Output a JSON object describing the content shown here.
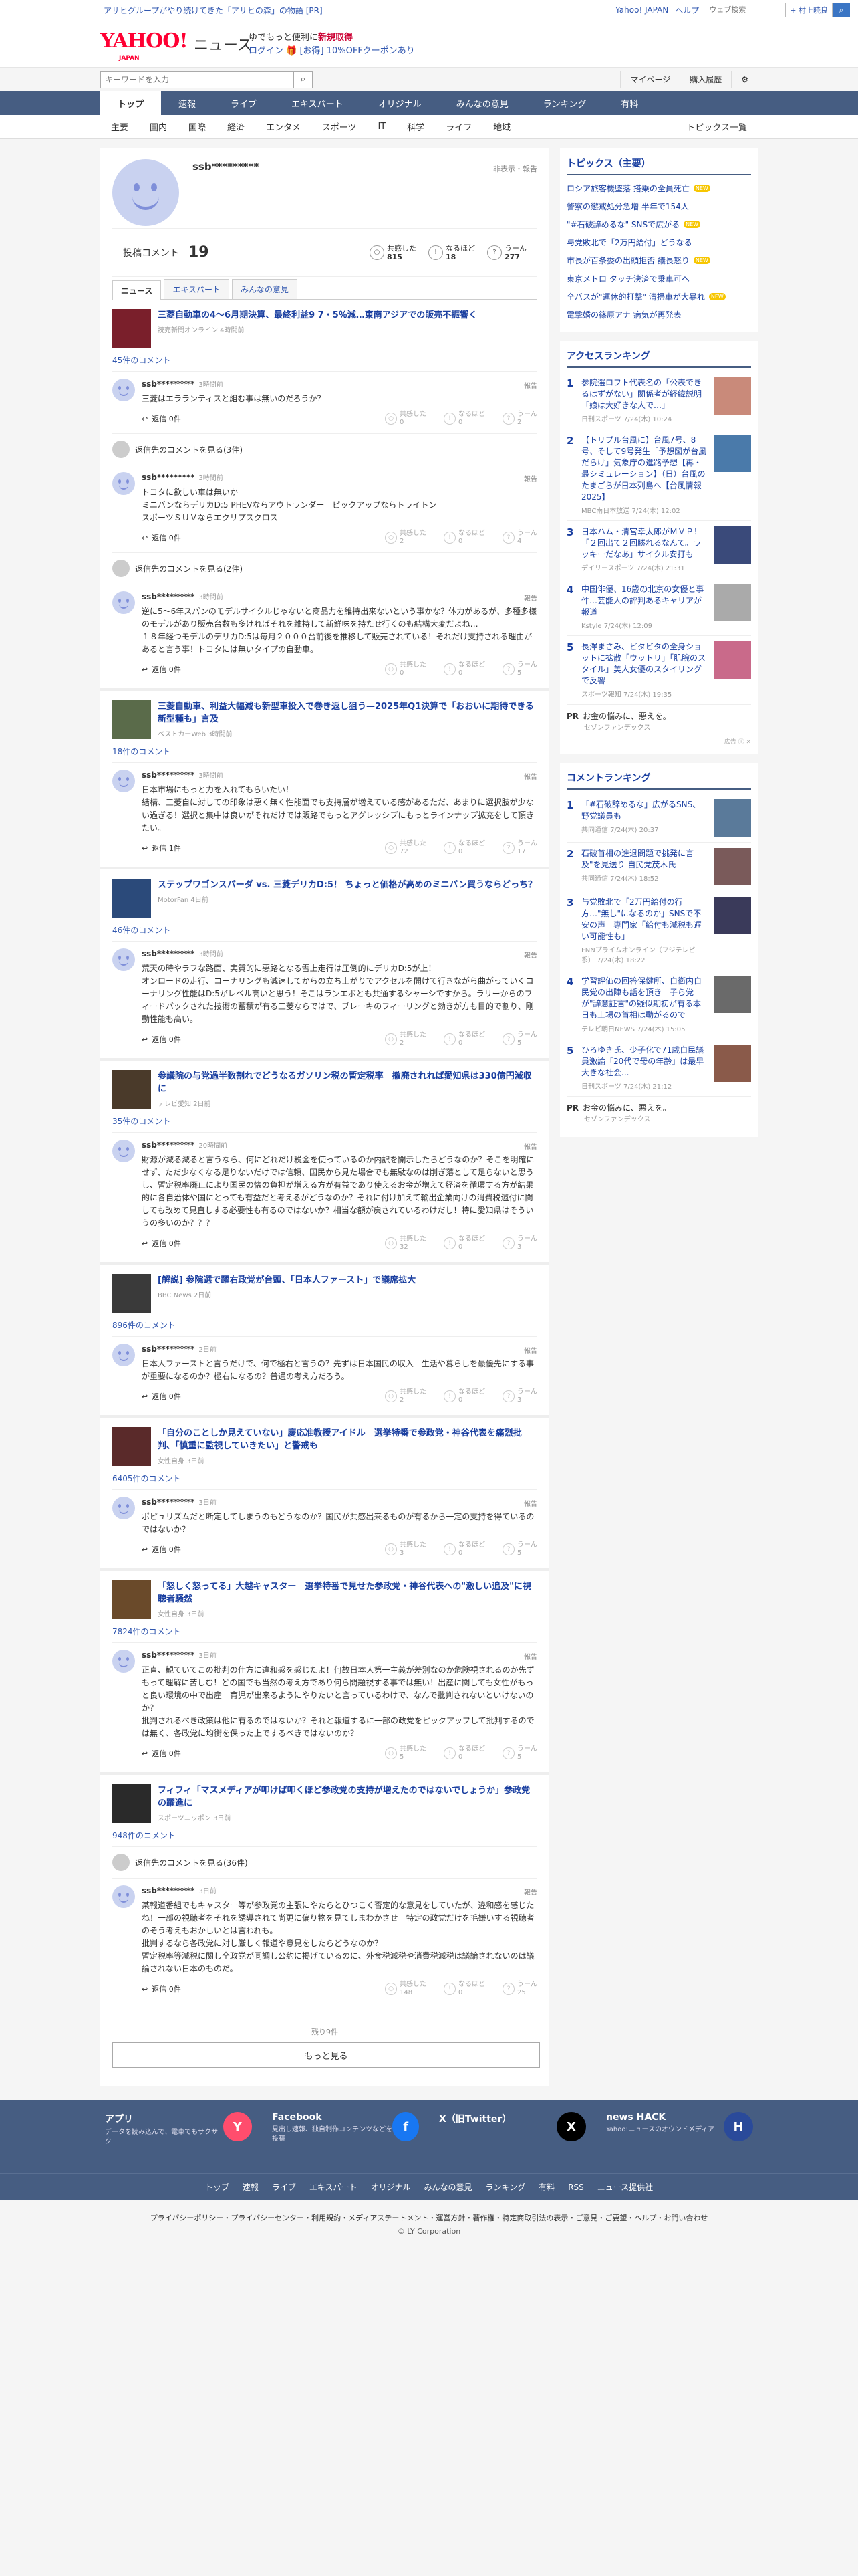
{
  "promo": {
    "text": "アサヒグループがやり続けてきた「アサヒの森」の物語 [PR]",
    "links": [
      "Yahoo! JAPAN",
      "ヘルプ"
    ],
    "search_placeholder": "ウェブ検索",
    "search_btn": "+ 村上暁良"
  },
  "header": {
    "logo": "YAHOO!",
    "logo_sub": "JAPAN",
    "news": "ニュース",
    "tag1": "ゆでもっと便利に",
    "tag1b": "新規取得",
    "login": "ログイン 🎁 [お得] 10%OFFクーポンあり"
  },
  "search": {
    "placeholder": "キーワードを入力",
    "mypage": "マイページ",
    "purchase": "購入履歴"
  },
  "gnav": [
    "トップ",
    "速報",
    "ライブ",
    "エキスパート",
    "オリジナル",
    "みんなの意見",
    "ランキング",
    "有料"
  ],
  "subnav": [
    "主要",
    "国内",
    "国際",
    "経済",
    "エンタメ",
    "スポーツ",
    "IT",
    "科学",
    "ライフ",
    "地域"
  ],
  "subnav_right": "トピックス一覧",
  "profile": {
    "name": "ssb*********",
    "report": "非表示・報告",
    "comment_label": "投稿コメント",
    "comment_count": "19"
  },
  "stats": [
    {
      "label": "共感した",
      "value": "815",
      "icon": "○"
    },
    {
      "label": "なるほど",
      "value": "18",
      "icon": "!"
    },
    {
      "label": "うーん",
      "value": "277",
      "icon": "?"
    }
  ],
  "tabs": [
    "ニュース",
    "エキスパート",
    "みんなの意見"
  ],
  "articles": [
    {
      "title": "三菱自動車の4～6月期決算、最終利益9 7・5％減…東南アジアでの販売不振響く",
      "src": "読売新聞オンライン 4時間前",
      "count": "45件のコメント",
      "thumb": "#7a1f2b",
      "comments": [
        {
          "name": "ssb*********",
          "time": "3時間前",
          "text": "三菱はエラランティスと組む事は無いのだろうか？",
          "reply": "返信 0件",
          "r": [
            "0",
            "0",
            "2"
          ]
        },
        {
          "more": "返信先のコメントを見る(3件)"
        },
        {
          "name": "ssb*********",
          "time": "3時間前",
          "text": "トヨタに欲しい車は無いか\nミニバンならデリカD:5 PHEVならアウトランダー　ピックアップならトライトン\nスポーツＳＵＶならエクリプスクロス",
          "reply": "返信 0件",
          "r": [
            "2",
            "0",
            "4"
          ]
        },
        {
          "more": "返信先のコメントを見る(2件)"
        },
        {
          "name": "ssb*********",
          "time": "3時間前",
          "text": "逆に5～6年スパンのモデルサイクルじゃないと商品力を維持出来ないという事かな？体力があるが、多種多様のモデルがあり販売台数も多ければそれを維持して新鮮味を持たせ行くのも結構大変だよね…\n１８年経つモデルのデリカD:5は毎月２０００台前後を推移して販売されている！それだけ支持される理由があると言う事！トヨタには無いタイプの自動車。",
          "reply": "返信 0件",
          "r": [
            "0",
            "0",
            "5"
          ]
        }
      ]
    },
    {
      "title": "三菱自動車、利益大幅減も新型車投入で巻き返し狙う—2025年Q1決算で「おおいに期待できる新型種も」言及",
      "src": "ベストカーWeb 3時間前",
      "count": "18件のコメント",
      "thumb": "#5a6b4a",
      "comments": [
        {
          "name": "ssb*********",
          "time": "3時間前",
          "text": "日本市場にもっと力を入れてもらいたい！\n結構、三菱自に対しての印象は悪く無く性能面でも支持層が増えている感があるただ、あまりに選択肢が少ない過ぎる！選択と集中は良いがそれだけでは販路でもっとアグレッシブにもっとラインナップ拡充をして頂きたい。",
          "reply": "返信 1件",
          "r": [
            "72",
            "0",
            "17"
          ]
        }
      ]
    },
    {
      "title": "ステップワゴンスパーダ vs. 三菱デリカD:5！ ちょっと価格が高めのミニバン買うならどっち？",
      "src": "MotorFan 4日前",
      "count": "46件のコメント",
      "thumb": "#2b4a7a",
      "comments": [
        {
          "name": "ssb*********",
          "time": "3時間前",
          "text": "荒天の時やラフな路面、実質的に悪路となる雪上走行は圧倒的にデリカD:5が上！\nオンロードの走行、コーナリングも減速してからの立ち上がりでアクセルを開けて行きながら曲がっていくコーナリング性能はD:5がレベル高いと思う！そこはランエボとも共通するシャーシですから。ラリーからのフィードバックされた技術の蓄積が有る三菱ならではで、ブレーキのフィーリングと効きが方も目的で割り、剛動性能も高い。",
          "reply": "返信 0件",
          "r": [
            "2",
            "0",
            "5"
          ]
        }
      ]
    },
    {
      "title": "参議院の与党過半数割れでどうなるガソリン税の暫定税率　撤廃されれば愛知県は330億円減収に",
      "src": "テレビ愛知 2日前",
      "count": "35件のコメント",
      "thumb": "#4a3a2a",
      "comments": [
        {
          "name": "ssb*********",
          "time": "20時間前",
          "text": "財源が減る減ると言うなら、何にどれだけ税金を使っているのか内訳を開示したらどうなのか？そこを明確にせず、ただ少なくなる足りないだけでは信頼、国民から見た場合でも無駄なのは削ぎ落として足らないと思うし、暫定税率廃止により国民の懐の負担が増える方が有益であり使えるお金が増えて経済を循環する方が結果的に各自治体や国にとっても有益だと考えるがどうなのか？それに付け加えて輸出企業向けの消費税還付に関しても改めて見直しする必要性も有るのではないか？相当な額が戻されているわけだし！特に愛知県はそういうの多いのか？？？",
          "reply": "返信 0件",
          "r": [
            "32",
            "0",
            "3"
          ]
        }
      ]
    },
    {
      "title": "[解説] 参院選で躍右政党が台頭、「日本人ファースト」で議席拡大",
      "src": "BBC News 2日前",
      "count": "896件のコメント",
      "thumb": "#3a3a3a",
      "comments": [
        {
          "name": "ssb*********",
          "time": "2日前",
          "text": "日本人ファーストと言うだけで、何で極右と言うの？先ずは日本国民の収入　生活や暮らしを最優先にする事が重要になるのか？極右になるの？普通の考え方だろう。",
          "reply": "返信 0件",
          "r": [
            "2",
            "0",
            "3"
          ]
        }
      ]
    },
    {
      "title": "「自分のことしか見えていない」慶応准教授アイドル　選挙特番で参政党・神谷代表を痛烈批判、「慎重に監視していきたい」と警戒も",
      "src": "女性自身 3日前",
      "count": "6405件のコメント",
      "thumb": "#5a2a2a",
      "comments": [
        {
          "name": "ssb*********",
          "time": "3日前",
          "text": "ポピュリズムだと断定してしまうのもどうなのか？国民が共感出来るものが有るから一定の支持を得ているのではないか？",
          "reply": "返信 0件",
          "r": [
            "3",
            "0",
            "5"
          ]
        }
      ]
    },
    {
      "title": "「怒しく怒ってる」大越キャスター　選挙特番で見せた参政党・神谷代表への\"激しい追及\"に視聴者騒然",
      "src": "女性自身 3日前",
      "count": "7824件のコメント",
      "thumb": "#6a4a2a",
      "comments": [
        {
          "name": "ssb*********",
          "time": "3日前",
          "text": "正直、観ていてこの批判の仕方に違和感を感じたよ！何故日本人第一主義が差別なのか危険視されるのか先ずもって理解に苦しむ！どの国でも当然の考え方であり何ら問題視する事では無い！出産に関しても女性がもっと良い環境の中で出産　育児が出来るようにやりたいと言っているわけで、なんで批判されないといけないのか？\n批判されるべき政策は他に有るのではないか？それと報道するに一部の政党をピックアップして批判するのでは無く、各政党に均衡を保った上でするべきではないのか？",
          "reply": "返信 0件",
          "r": [
            "5",
            "0",
            "5"
          ]
        }
      ]
    },
    {
      "title": "フィフィ「マスメディアが叩けば叩くほど参政党の支持が増えたのではないでしょうか」参政党の躍進に",
      "src": "スポーツニッポン 3日前",
      "count": "948件のコメント",
      "thumb": "#2a2a2a",
      "comments": [
        {
          "more": "返信先のコメントを見る(36件)"
        },
        {
          "name": "ssb*********",
          "time": "3日前",
          "text": "某報道番組でもキャスター等が参政党の主張にやたらとひつこく否定的な意見をしていたが、違和感を感じたね！一部の視聴者をそれを誘導されて尚更に偏り物を見てしまわかさせ　特定の政党だけを毛嫌いする視聴者のそう考えもおかしいとは言われも。\n批判するなら各政党に対し厳しく報道や意見をしたらどうなのか？\n暫定税率等減税に関し全政党が同調し公約に掲げているのに、外食税減税や消費税減税は議論されないのは議論されない日本のものだ。",
          "reply": "返信 0件",
          "r": [
            "148",
            "0",
            "25"
          ]
        }
      ]
    }
  ],
  "footer_main": {
    "total": "残り9件",
    "more": "もっと見る"
  },
  "sidebar": {
    "topics_title": "トピックス（主要）",
    "topics": [
      {
        "t": "ロシア旅客機墜落 搭乗の全員死亡",
        "n": true
      },
      {
        "t": "警察の懲戒処分急増 半年で154人",
        "n": false
      },
      {
        "t": "\"#石破辞めるな\" SNSで広がる",
        "n": true
      },
      {
        "t": "与党敗北で「2万円給付」どうなる",
        "n": false
      },
      {
        "t": "市長が百条委の出頭拒否 議長怒り",
        "n": true
      },
      {
        "t": "東京メトロ タッチ決済で乗車可へ",
        "n": false
      },
      {
        "t": "全バスが\"運休的打撃\" 清掃車が大暴れ",
        "n": true
      },
      {
        "t": "電撃婚の篠原アナ 病気が再発表",
        "n": false
      }
    ],
    "access_title": "アクセスランキング",
    "access": [
      {
        "n": "1",
        "t": "参院選ロフト代表名の「公表できるはずがない」関係者が経緯説明「娘は大好きな人で…」",
        "s": "日刊スポーツ 7/24(木) 10:24",
        "c": "#c98a7a"
      },
      {
        "n": "2",
        "t": "【トリプル台風に】台風7号、8号、そして9号発生「予想図が台風だらけ」気象庁の進路予想【再・最シミュレーション】（日）台風のたまごらが日本列島へ【台風情報2025】",
        "s": "MBC南日本放送 7/24(木) 12:02",
        "c": "#4a7aaa"
      },
      {
        "n": "3",
        "t": "日本ハム・清宮幸太郎がＭＶＰ！「２回出て２回勝れるなんて。ラッキーだなあ」サイクル安打も",
        "s": "デイリースポーツ 7/24(木) 21:31",
        "c": "#3a4a7a"
      },
      {
        "n": "4",
        "t": "中国俳優、16歳の北京の女優と事件…芸能人の評判あるキャリアが報道",
        "s": "Kstyle 7/24(木) 12:09",
        "c": "#aaaaaa"
      },
      {
        "n": "5",
        "t": "長澤まさみ、ビタビタの全身ショットに拡散「ウットリ」「肌腕のスタイル」美人女優のスタイリングで反響",
        "s": "スポーツ報知 7/24(木) 19:35",
        "c": "#c96a8a"
      }
    ],
    "pr1": {
      "t": "お金の悩みに、悪えを。",
      "adv": "セゾンファンデックス"
    },
    "comment_title": "コメントランキング",
    "comments": [
      {
        "n": "1",
        "t": "「#石破辞めるな」広がるSNS、野党議員も",
        "s": "共同通信 7/24(木) 20:37",
        "c": "#5a7a9a"
      },
      {
        "n": "2",
        "t": "石破首相の進退問題で挑発に言及\"を見送り 自民党茂木氏",
        "s": "共同通信 7/24(木) 18:52",
        "c": "#7a5a5a"
      },
      {
        "n": "3",
        "t": "与党敗北で「2万円給付の行方…\"無し\"になるのか」SNSで不安の声　専門家「給付も減税も遅い可能性も」",
        "s": "FNNプライムオンライン（フジテレビ系） 7/24(木) 18:22",
        "c": "#3a3a5a"
      },
      {
        "n": "4",
        "t": "学習評価の回答保健所、自衛内自民党の出陣も話を頂き　子ら党が\"辞意証言\"の疑似期初が有る本日も上場の首相は動がるので",
        "s": "テレビ朝日NEWS 7/24(木) 15:05",
        "c": "#6a6a6a"
      },
      {
        "n": "5",
        "t": "ひろゆき氏、少子化で71歳自民議員激論「20代で母の年齢」は最早大きな社会...",
        "s": "日刊スポーツ 7/24(木) 21:12",
        "c": "#8a5a4a"
      }
    ],
    "pr2": {
      "t": "お金の悩みに、悪えを。",
      "adv": "セゾンファンデックス"
    }
  },
  "footer": {
    "apps": [
      {
        "t": "アプリ",
        "d": "データを読み込んで、電車でもサクサク",
        "icon": "Y",
        "c": "#ff4d6d"
      },
      {
        "t": "Facebook",
        "d": "見出し速報、独自制作コンテンツなどを投稿",
        "icon": "f",
        "c": "#1877f2"
      },
      {
        "t": "X（旧Twitter）",
        "d": "",
        "icon": "X",
        "c": "#000000"
      },
      {
        "t": "news HACK",
        "d": "Yahoo!ニュースのオウンドメディア",
        "icon": "H",
        "c": "#2a4a9a"
      }
    ],
    "nav": [
      "トップ",
      "速報",
      "ライブ",
      "エキスパート",
      "オリジナル",
      "みんなの意見",
      "ランキング",
      "有料",
      "RSS",
      "ニュース提供社"
    ],
    "links": "プライバシーポリシー・プライバシーセンター・利用規約・メディアステートメント・運営方針・著作権・特定商取引法の表示・ご意見・ご要望・ヘルプ・お問い合わせ",
    "copy": "© LY Corporation"
  }
}
